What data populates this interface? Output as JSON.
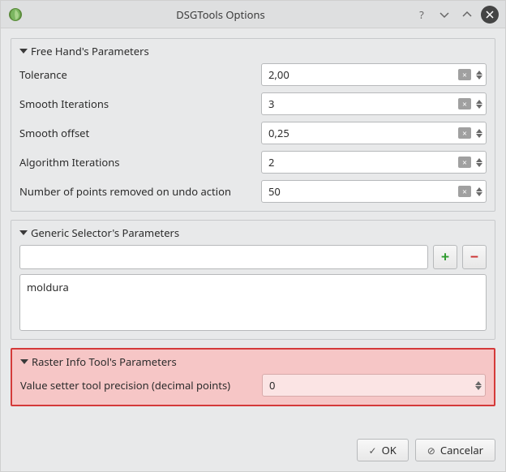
{
  "window": {
    "title": "DSGTools Options"
  },
  "groups": {
    "freehand": {
      "title": "Free Hand's Parameters",
      "tolerance_label": "Tolerance",
      "tolerance_value": "2,00",
      "smooth_iter_label": "Smooth Iterations",
      "smooth_iter_value": "3",
      "smooth_offset_label": "Smooth offset",
      "smooth_offset_value": "0,25",
      "algo_iter_label": "Algorithm Iterations",
      "algo_iter_value": "2",
      "undo_points_label": "Number of points removed on undo action",
      "undo_points_value": "50"
    },
    "generic_selector": {
      "title": "Generic Selector's Parameters",
      "input_value": "",
      "list_item_0": "moldura"
    },
    "raster": {
      "title": "Raster Info Tool's Parameters",
      "precision_label": "Value setter tool precision (decimal points)",
      "precision_value": "0"
    }
  },
  "buttons": {
    "ok": "OK",
    "cancel": "Cancelar"
  }
}
